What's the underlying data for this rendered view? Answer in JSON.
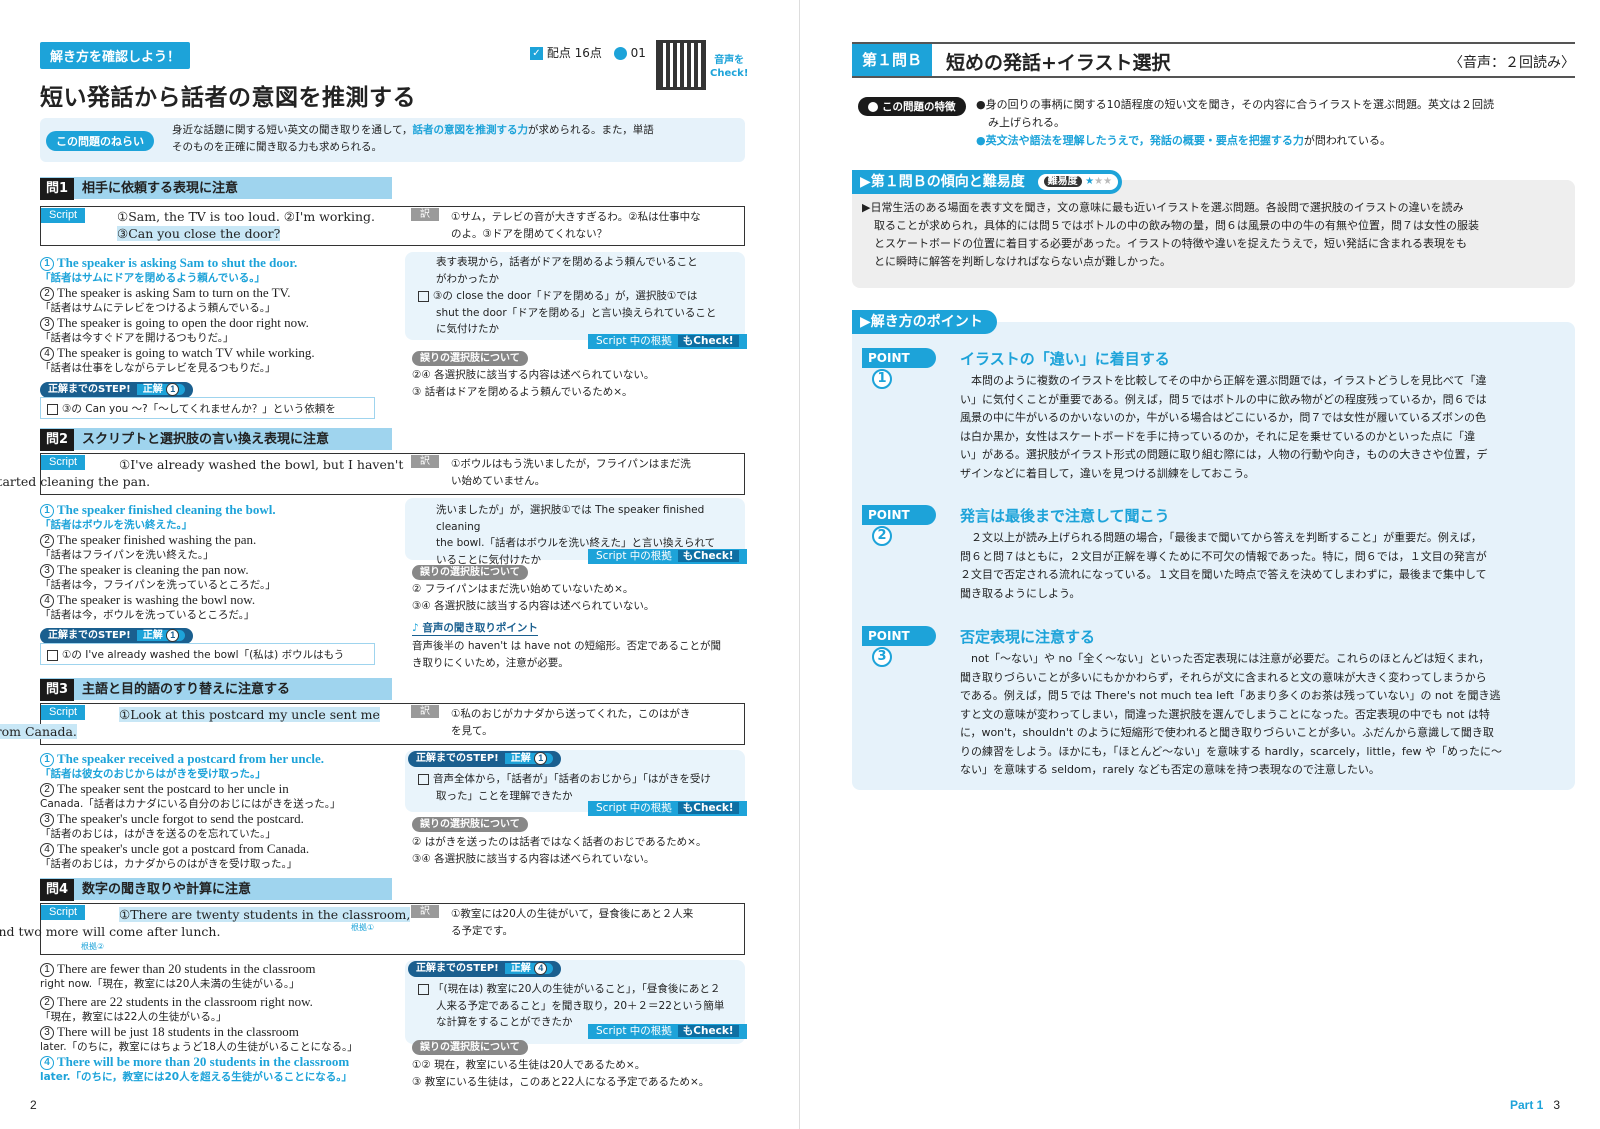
{
  "left": {
    "tag": "解き方を確認しよう！",
    "title": "短い発話から話者の意図を推測する",
    "score": "配点 16点",
    "track": "01",
    "qr_label_1": "音声を",
    "qr_label_2": "Check!",
    "aim_label": "この問題のねらい",
    "aim_text_1": "身近な話題に関する短い英文の聞き取りを通して，",
    "aim_text_hl": "話者の意図を推測する力",
    "aim_text_2": "が求められる。また，単語",
    "aim_text_3": "そのものを正確に聞き取る力も求められる。",
    "script_label": "Script",
    "yaku_label": "訳",
    "konkyo": "根拠",
    "check_label": "Script 中の根拠",
    "check_suffix": "もCheck!",
    "err_label": "誤りの選択肢について",
    "step_label": "正解までのSTEP!",
    "seikai": "正解",
    "q1": {
      "num": "問1",
      "title": "相手に依頼する表現に注意",
      "script_1": "①Sam, the TV is too loud. ②I'm working.",
      "script_2": "③Can you close the door?",
      "yaku_1": "①サム，テレビの音が大きすぎるわ。②私は仕事中な",
      "yaku_2": "のよ。③ドアを閉めてくれない？",
      "opts": [
        {
          "en": "The speaker is asking Sam to shut the door.",
          "jp": "「話者はサムにドアを閉めるよう頼んでいる。」"
        },
        {
          "en": "The speaker is asking Sam to turn on the TV.",
          "jp": "「話者はサムにテレビをつけるよう頼んでいる。」"
        },
        {
          "en": "The speaker is going to open the door right now.",
          "jp": "「話者は今すぐドアを開けるつもりだ。」"
        },
        {
          "en": "The speaker is going to watch TV while working.",
          "jp": "「話者は仕事をしながらテレビを見るつもりだ。」"
        }
      ],
      "right_1": "表す表現から，話者がドアを閉めるよう頼んでいること",
      "right_2": "がわかったか",
      "right_3": "③の close the door「ドアを閉める」が，選択肢①では",
      "right_4": "shut the door「ドアを閉める」と言い換えられていること",
      "right_5": "に気付けたか",
      "err_1": "②④ 各選択肢に該当する内容は述べられていない。",
      "err_2": "③ 話者はドアを閉めるよう頼んでいるため×。",
      "answer": "1",
      "step_text": "③の Can you ～?「～してくれませんか？」という依頼を"
    },
    "q2": {
      "num": "問2",
      "title": "スクリプトと選択肢の言い換え表現に注意",
      "script_1": "①I've already washed the bowl, but I haven't",
      "script_2": "started cleaning the pan.",
      "yaku_1": "①ボウルはもう洗いましたが，フライパンはまだ洗",
      "yaku_2": "い始めていません。",
      "opts": [
        {
          "en": "The speaker finished cleaning the bowl.",
          "jp": "「話者はボウルを洗い終えた。」"
        },
        {
          "en": "The speaker finished washing the pan.",
          "jp": "「話者はフライパンを洗い終えた。」"
        },
        {
          "en": "The speaker is cleaning the pan now.",
          "jp": "「話者は今，フライパンを洗っているところだ。」"
        },
        {
          "en": "The speaker is washing the bowl now.",
          "jp": "「話者は今，ボウルを洗っているところだ。」"
        }
      ],
      "right_1": "洗いましたが」が，選択肢①では The speaker finished cleaning",
      "right_2": "the bowl.「話者はボウルを洗い終えた」と言い換えられて",
      "right_3": "いることに気付けたか",
      "err_1": "② フライパンはまだ洗い始めていないため×。",
      "err_2": "③④ 各選択肢に該当する内容は述べられていない。",
      "listen_label": "音声の聞き取りポイント",
      "listen_1": "音声後半の haven't は have not の短縮形。否定であることが聞",
      "listen_2": "き取りにくいため，注意が必要。",
      "answer": "1",
      "step_text": "①の I've already washed the bowl「(私は) ボウルはもう"
    },
    "q3": {
      "num": "問3",
      "title": "主語と目的語のすり替えに注意する",
      "script_1": "①Look at this postcard my uncle sent me",
      "script_2": "from Canada.",
      "yaku_1": "①私のおじがカナダから送ってくれた，このはがき",
      "yaku_2": "を見て。",
      "opts": [
        {
          "en": "The speaker received a postcard from her uncle.",
          "jp": "「話者は彼女のおじからはがきを受け取った。」"
        },
        {
          "en": "The speaker sent the postcard to her uncle in",
          "jp": "Canada.「話者はカナダにいる自分のおじにはがきを送った。」"
        },
        {
          "en": "The speaker's uncle forgot to send the postcard.",
          "jp": "「話者のおじは，はがきを送るのを忘れていた。」"
        },
        {
          "en": "The speaker's uncle got a postcard from Canada.",
          "jp": "「話者のおじは，カナダからのはがきを受け取った。」"
        }
      ],
      "answer": "1",
      "right_1": "音声全体から，「話者が」「話者のおじから」「はがきを受け",
      "right_2": "取った」ことを理解できたか",
      "err_1": "② はがきを送ったのは話者ではなく話者のおじであるため×。",
      "err_2": "③④ 各選択肢に該当する内容は述べられていない。"
    },
    "q4": {
      "num": "問4",
      "title": "数字の聞き取りや計算に注意",
      "script_1": "①There are twenty students in the classroom,",
      "script_2": "and two more will come after lunch.",
      "konkyo1": "根拠①",
      "konkyo2": "根拠②",
      "yaku_1": "①教室には20人の生徒がいて，昼食後にあと２人来",
      "yaku_2": "る予定です。",
      "opts": [
        {
          "en": "There are fewer than 20 students in the classroom",
          "jp": "right now.「現在，教室には20人未満の生徒がいる。」"
        },
        {
          "en": "There are 22 students in the classroom right now.",
          "jp": "「現在，教室には22人の生徒がいる。」"
        },
        {
          "en": "There will be just 18 students in the classroom",
          "jp": "later.「のちに，教室にはちょうど18人の生徒がいることになる。」"
        },
        {
          "en": "There will be more than 20 students in the classroom",
          "jp": "later.「のちに，教室には20人を超える生徒がいることになる。」"
        }
      ],
      "answer": "4",
      "right_1": "「(現在は) 教室に20人の生徒がいること」，「昼食後にあと２",
      "right_2": "人来る予定であること」を聞き取り，20＋２＝22という簡単",
      "right_3": "な計算をすることができたか",
      "err_1": "①② 現在，教室にいる生徒は20人であるため×。",
      "err_2": "③ 教室にいる生徒は，このあと22人になる予定であるため×。"
    },
    "page_num": "2"
  },
  "right": {
    "q_label": "第１問Ｂ",
    "title": "短めの発話+イラスト選択",
    "audio": "〈音声：２回読み〉",
    "feature_label": "この問題の特徴",
    "feature_1": "●身の回りの事柄に関する10語程度の短い文を聞き，その内容に合うイラストを選ぶ問題。英文は２回読",
    "feature_2": "み上げられる。",
    "feature_3": "●英文法や語法を理解したうえで，発話の概要・要点を把握する力",
    "feature_4": "が問われている。",
    "trend_title": "▶第１問Ｂの傾向と難易度",
    "difficulty_label": "難易度",
    "difficulty_stars": 1,
    "trend_text": [
      "▶日常生活のある場面を表す文を聞き，文の意味に最も近いイラストを選ぶ問題。各設問で選択肢のイラストの違いを読み",
      "取ることが求められ，具体的には問５ではボトルの中の飲み物の量，問６は風景の中の牛の有無や位置，問７は女性の服装",
      "とスケートボードの位置に着目する必要があった。イラストの特徴や違いを捉えたうえで，短い発話に含まれる表現をも",
      "とに瞬時に解答を判断しなければならない点が難しかった。"
    ],
    "points_title": "▶解き方のポイント",
    "points": [
      {
        "label": "POINT",
        "num": "1",
        "title": "イラストの「違い」に着目する",
        "lines": [
          "本問のように複数のイラストを比較してその中から正解を選ぶ問題では，イラストどうしを見比べて「違",
          "い」に気付くことが重要である。例えば，問５ではボトルの中に飲み物がどの程度残っているか，問６では",
          "風景の中に牛がいるのかいないのか，牛がいる場合はどこにいるか，問７では女性が履いているズボンの色",
          "は白か黒か，女性はスケートボードを手に持っているのか，それに足を乗せているのかといった点に「違",
          "い」がある。選択肢がイラスト形式の問題に取り組む際には，人物の行動や向き，ものの大きさや位置，デ",
          "ザインなどに着目して，違いを見つける訓練をしておこう。"
        ]
      },
      {
        "label": "POINT",
        "num": "2",
        "title": "発言は最後まで注意して聞こう",
        "lines": [
          "２文以上が読み上げられる問題の場合，「最後まで聞いてから答えを判断すること」が重要だ。例えば，",
          "問６と問７はともに，２文目が正解を導くために不可欠の情報であった。特に，問６では，１文目の発言が",
          "２文目で否定される流れになっている。１文目を聞いた時点で答えを決めてしまわずに，最後まで集中して",
          "聞き取るようにしよう。"
        ]
      },
      {
        "label": "POINT",
        "num": "3",
        "title": "否定表現に注意する",
        "lines": [
          "not「～ない」や no「全く～ない」といった否定表現には注意が必要だ。これらのほとんどは短くまれ，",
          "聞き取りづらいことが多いにもかかわらず，それらが文に含まれると文の意味が大きく変わってしまうから",
          "である。例えば，問５では There's not much tea left「あまり多くのお茶は残っていない」の not を聞き逃",
          "すと文の意味が変わってしまい，間違った選択肢を選んでしまうことになった。否定表現の中でも not は特",
          "に，won't，shouldn't のように短縮形で使われると聞き取りづらいことが多い。ふだんから意識して聞き取",
          "りの練習をしよう。ほかにも，「ほとんど～ない」を意味する hardly，scarcely，little，few や「めったに～",
          "ない」を意味する seldom，rarely なども否定の意味を持つ表現なので注意したい。"
        ]
      }
    ],
    "part_label": "Part 1",
    "page_num": "3"
  },
  "colors": {
    "accent": "#1da3d9",
    "bar": "#9fd4ee",
    "panel": "#e9f4fb",
    "gray": "#eeeeee"
  }
}
